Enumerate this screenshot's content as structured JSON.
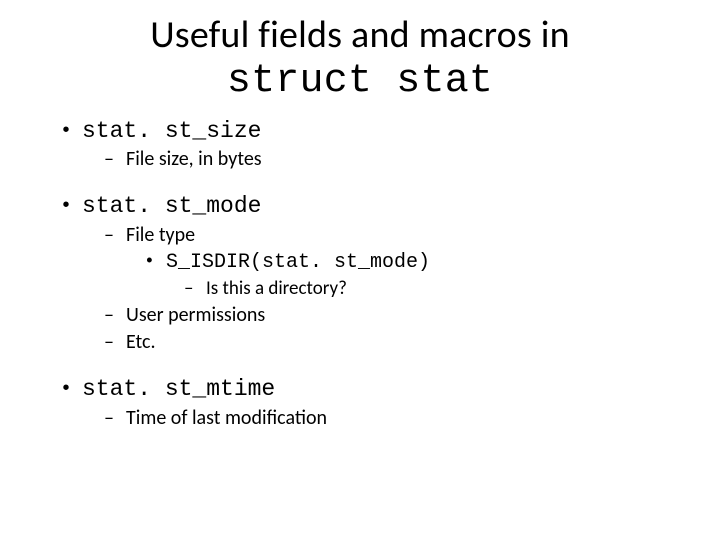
{
  "title_line1": "Useful fields and macros in",
  "title_line2": "struct stat",
  "items": [
    {
      "label": "stat. st_size",
      "mono": true,
      "sub": [
        {
          "label": "File size, in bytes"
        }
      ]
    },
    {
      "label": "stat. st_mode",
      "mono": true,
      "sub": [
        {
          "label": "File type",
          "sub2": [
            {
              "label": "S_ISDIR(stat. st_mode)",
              "mono": true,
              "sub3": [
                {
                  "label": "Is this a directory?"
                }
              ]
            }
          ]
        },
        {
          "label": "User permissions"
        },
        {
          "label": "Etc."
        }
      ]
    },
    {
      "label": "stat. st_mtime",
      "mono": true,
      "sub": [
        {
          "label": "Time of last modification"
        }
      ]
    }
  ]
}
